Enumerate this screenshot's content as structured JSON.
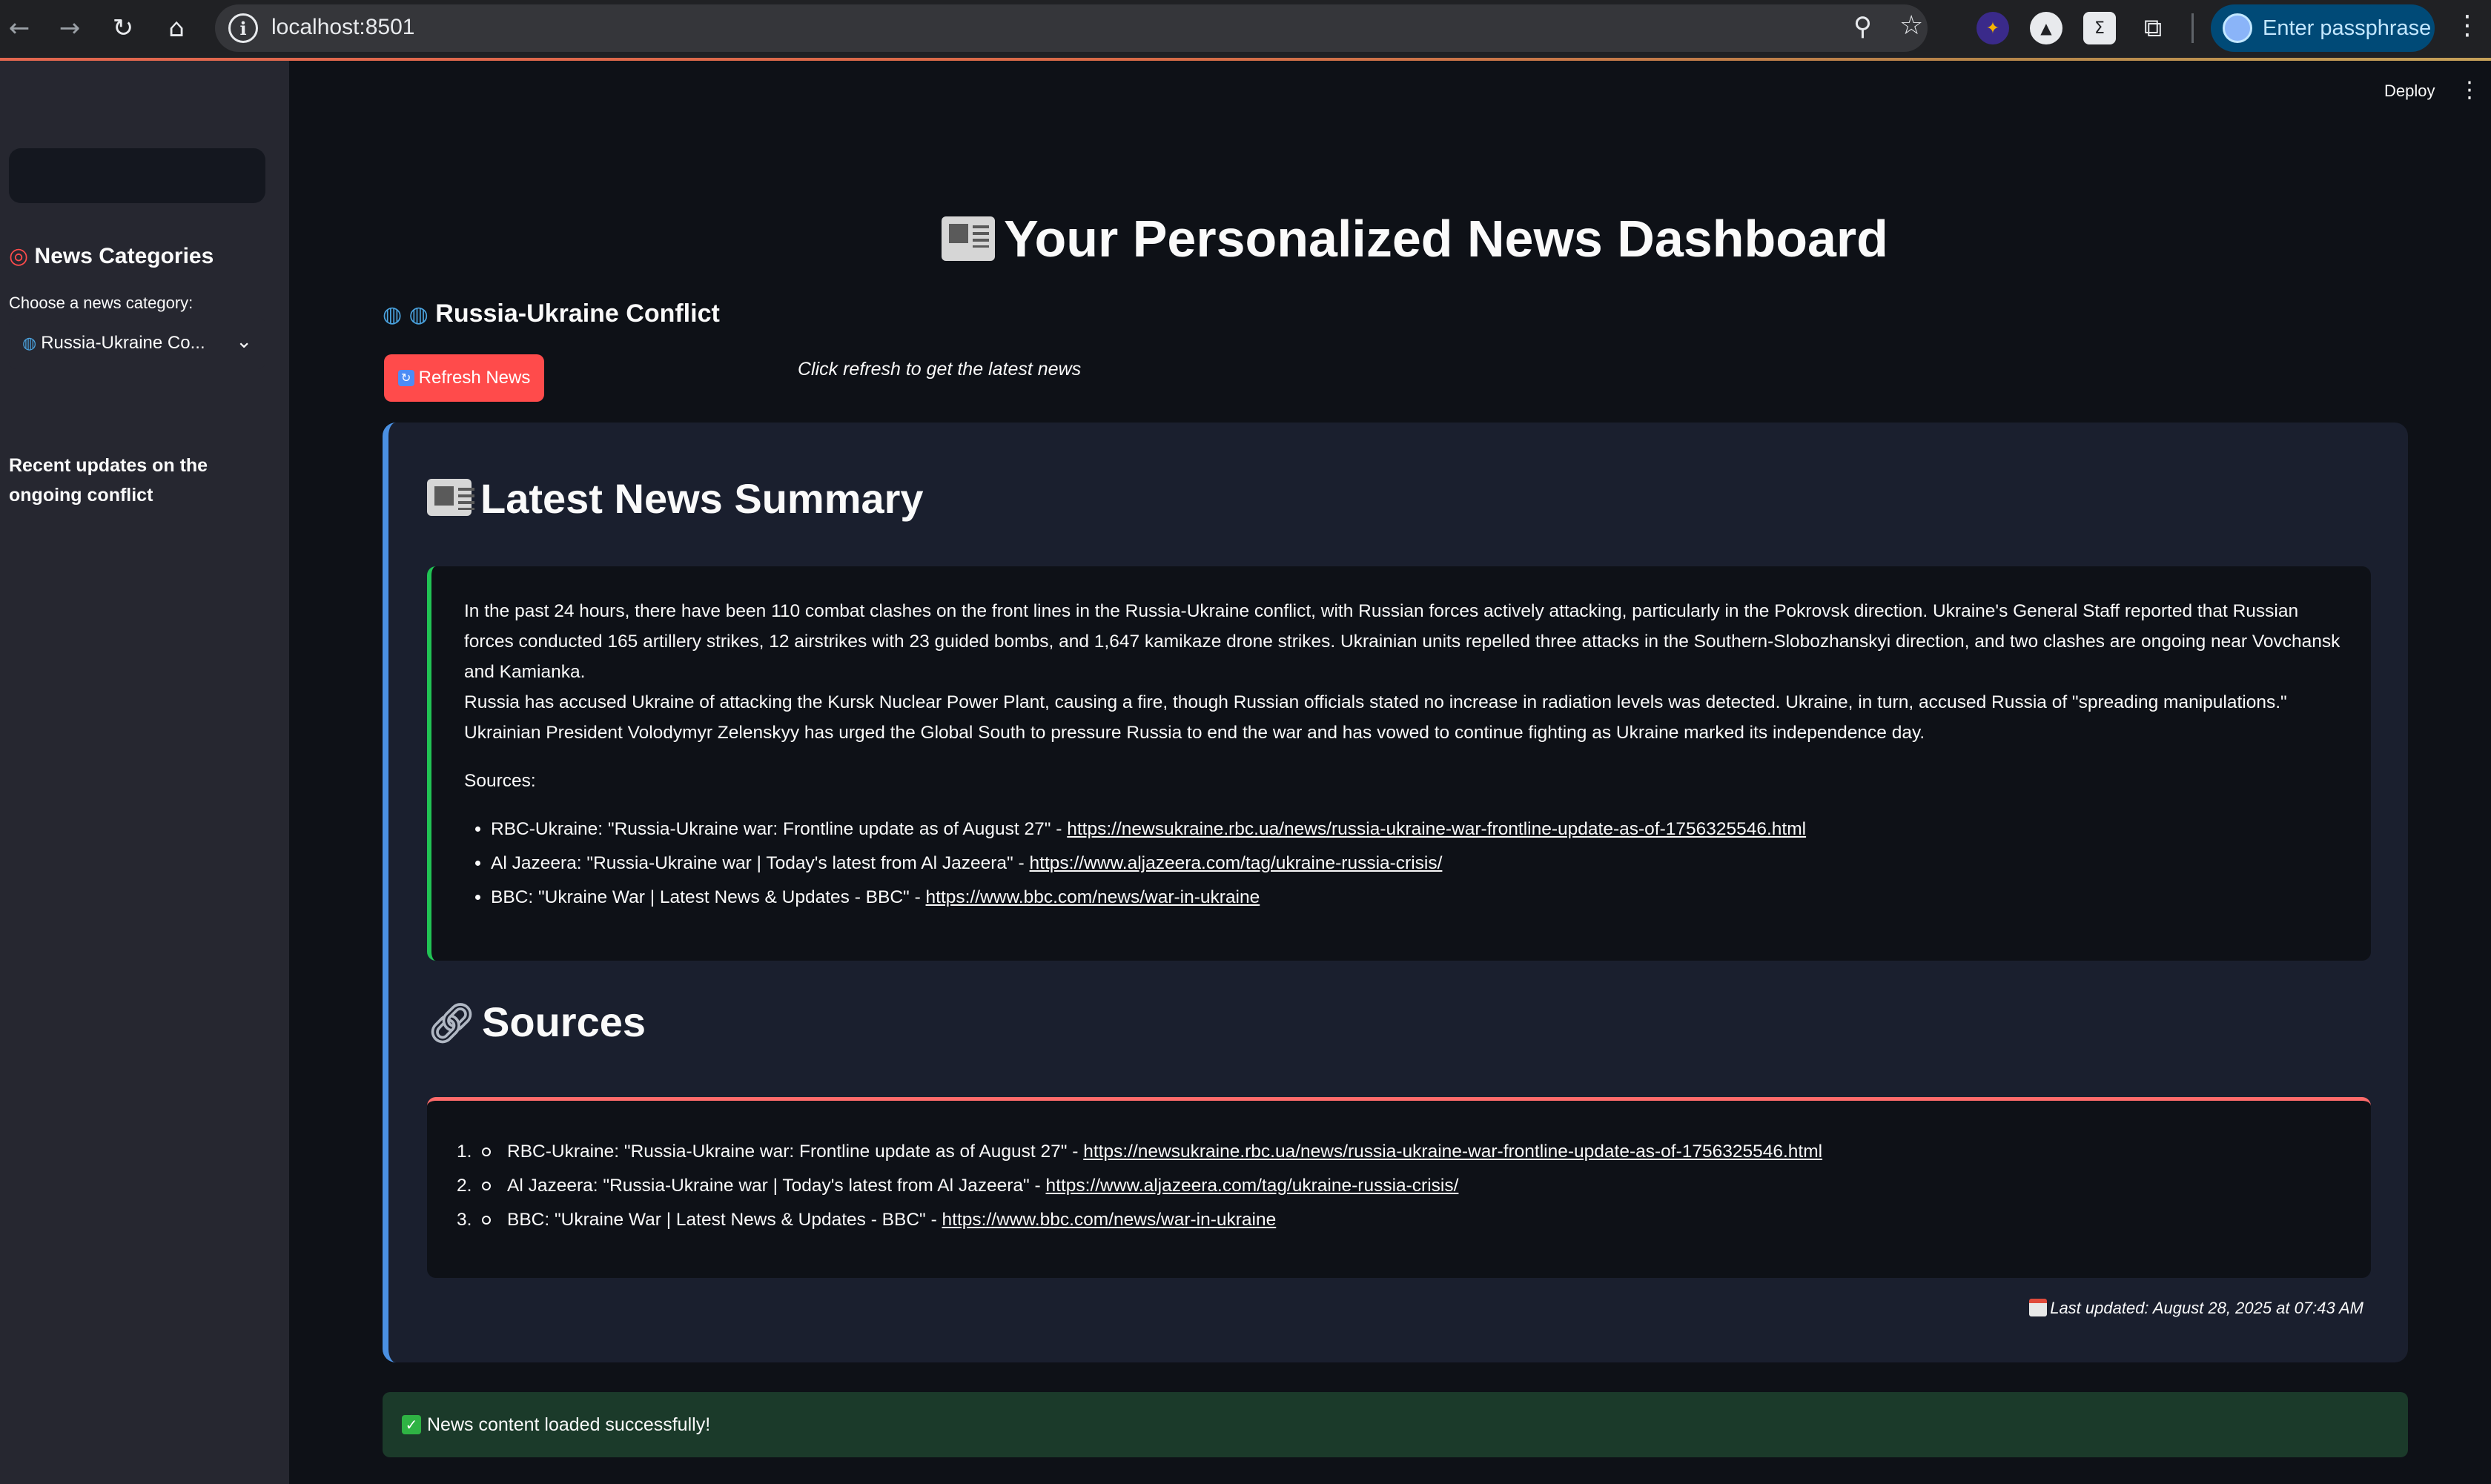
{
  "browser": {
    "url": "localhost:8501",
    "passphrase_button": "Enter passphrase"
  },
  "sidebar": {
    "title": "News Categories",
    "select_label": "Choose a news category:",
    "selected_category": "Russia-Ukraine Co...",
    "description": "Recent updates on the ongoing conflict"
  },
  "header": {
    "deploy_label": "Deploy"
  },
  "main": {
    "title": "Your Personalized News Dashboard",
    "category_heading": "Russia-Ukraine Conflict",
    "refresh_button": "Refresh News",
    "refresh_hint": "Click refresh to get the latest news",
    "summary_title": "Latest News Summary",
    "summary_paragraph_1": "In the past 24 hours, there have been 110 combat clashes on the front lines in the Russia-Ukraine conflict, with Russian forces actively attacking, particularly in the Pokrovsk direction. Ukraine's General Staff reported that Russian forces conducted 165 artillery strikes, 12 airstrikes with 23 guided bombs, and 1,647 kamikaze drone strikes. Ukrainian units repelled three attacks in the Southern-Slobozhanskyi direction, and two clashes are ongoing near Vovchansk and Kamianka.",
    "summary_paragraph_2": "Russia has accused Ukraine of attacking the Kursk Nuclear Power Plant, causing a fire, though Russian officials stated no increase in radiation levels was detected. Ukraine, in turn, accused Russia of \"spreading manipulations.\" Ukrainian President Volodymyr Zelenskyy has urged the Global South to pressure Russia to end the war and has vowed to continue fighting as Ukraine marked its independence day.",
    "summary_sources_label": "Sources:",
    "summary_sources": [
      {
        "text": "RBC-Ukraine: \"Russia-Ukraine war: Frontline update as of August 27\" - ",
        "url": "https://newsukraine.rbc.ua/news/russia-ukraine-war-frontline-update-as-of-1756325546.html"
      },
      {
        "text": "Al Jazeera: \"Russia-Ukraine war | Today's latest from Al Jazeera\" - ",
        "url": "https://www.aljazeera.com/tag/ukraine-russia-crisis/"
      },
      {
        "text": "BBC: \"Ukraine War | Latest News & Updates - BBC\" - ",
        "url": "https://www.bbc.com/news/war-in-ukraine"
      }
    ],
    "sources_title": "Sources",
    "sources_list": [
      {
        "num": "1.",
        "text": "RBC-Ukraine: \"Russia-Ukraine war: Frontline update as of August 27\" - ",
        "url": "https://newsukraine.rbc.ua/news/russia-ukraine-war-frontline-update-as-of-1756325546.html"
      },
      {
        "num": "2.",
        "text": "Al Jazeera: \"Russia-Ukraine war | Today's latest from Al Jazeera\" - ",
        "url": "https://www.aljazeera.com/tag/ukraine-russia-crisis/"
      },
      {
        "num": "3.",
        "text": "BBC: \"Ukraine War | Latest News & Updates - BBC\" - ",
        "url": "https://www.bbc.com/news/war-in-ukraine"
      }
    ],
    "last_updated": "Last updated: August 28, 2025 at 07:43 AM",
    "success_message": "News content loaded successfully!"
  }
}
